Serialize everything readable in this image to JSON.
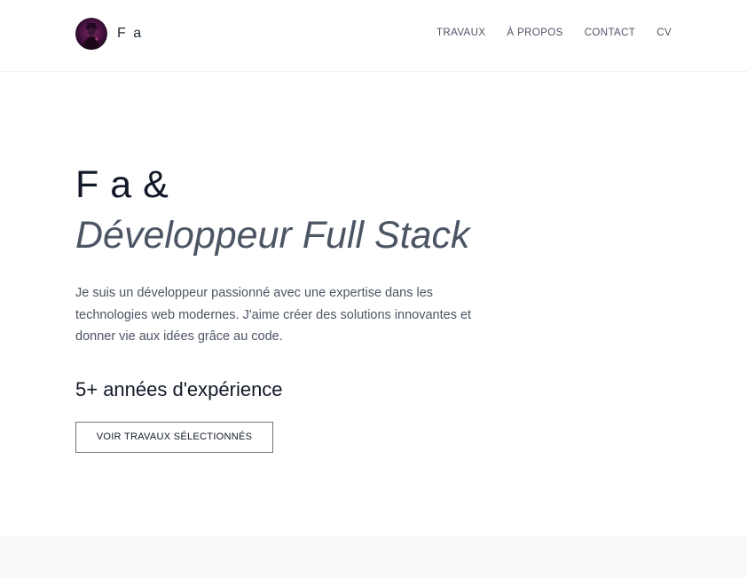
{
  "header": {
    "brand_name": "F a",
    "avatar_icon": "avatar-icon",
    "nav": [
      {
        "label": "TRAVAUX"
      },
      {
        "label": "À PROPOS"
      },
      {
        "label": "CONTACT"
      },
      {
        "label": "CV"
      }
    ]
  },
  "hero": {
    "line1": "F a &",
    "line2": "Développeur Full Stack",
    "description": "Je suis un développeur passionné avec une expertise dans les technologies web modernes. J'aime créer des solutions innovantes et donner vie aux idées grâce au code.",
    "experience": "5+ années d'expérience",
    "cta_label": "VOIR TRAVAUX SÉLECTIONNÉS"
  },
  "colors": {
    "heading": "#111827",
    "muted": "#4b5563",
    "section_bg": "#f8f9fb"
  }
}
